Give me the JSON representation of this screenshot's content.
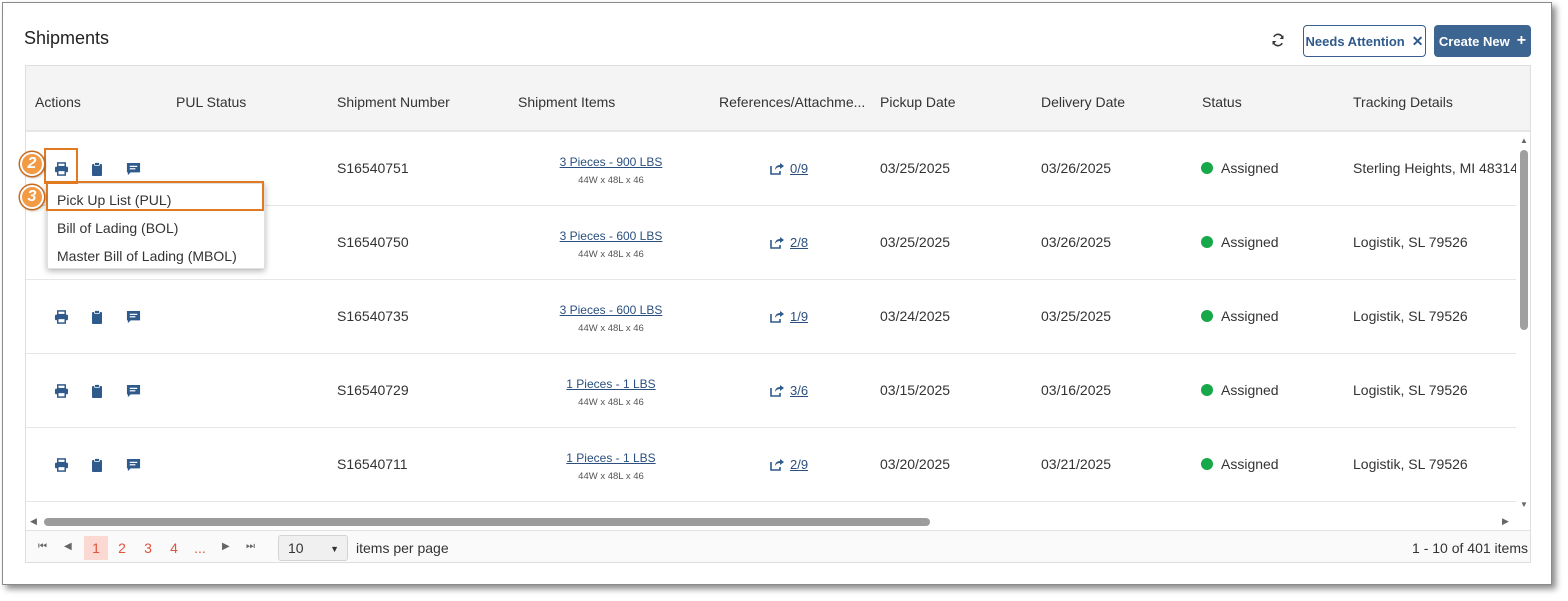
{
  "page": {
    "title": "Shipments"
  },
  "toolbar": {
    "needs_attention_label": "Needs Attention",
    "needs_attention_close": "✕",
    "create_new_label": "Create New",
    "create_new_icon": "+"
  },
  "columns": {
    "actions": "Actions",
    "pul_status": "PUL Status",
    "shipment_number": "Shipment Number",
    "shipment_items": "Shipment Items",
    "references": "References/Attachme...",
    "pickup_date": "Pickup Date",
    "delivery_date": "Delivery Date",
    "status": "Status",
    "tracking": "Tracking Details"
  },
  "rows": [
    {
      "number": "S16540751",
      "items": "3 Pieces - 900 LBS",
      "dims": "44W x 48L x 46",
      "refs": "0/9",
      "pickup": "03/25/2025",
      "delivery": "03/26/2025",
      "status": "Assigned",
      "tracking": "Sterling Heights, MI 48314"
    },
    {
      "number": "S16540750",
      "items": "3 Pieces - 600 LBS",
      "dims": "44W x 48L x 46",
      "refs": "2/8",
      "pickup": "03/25/2025",
      "delivery": "03/26/2025",
      "status": "Assigned",
      "tracking": "Logistik, SL 79526"
    },
    {
      "number": "S16540735",
      "items": "3 Pieces - 600 LBS",
      "dims": "44W x 48L x 46",
      "refs": "1/9",
      "pickup": "03/24/2025",
      "delivery": "03/25/2025",
      "status": "Assigned",
      "tracking": "Logistik, SL 79526"
    },
    {
      "number": "S16540729",
      "items": "1 Pieces - 1 LBS",
      "dims": "44W x 48L x 46",
      "refs": "3/6",
      "pickup": "03/15/2025",
      "delivery": "03/16/2025",
      "status": "Assigned",
      "tracking": "Logistik, SL 79526"
    },
    {
      "number": "S16540711",
      "items": "1 Pieces - 1 LBS",
      "dims": "44W x 48L x 46",
      "refs": "2/9",
      "pickup": "03/20/2025",
      "delivery": "03/21/2025",
      "status": "Assigned",
      "tracking": "Logistik, SL 79526"
    }
  ],
  "print_menu": {
    "items": [
      "Pick Up List (PUL)",
      "Bill of Lading (BOL)",
      "Master Bill of Lading (MBOL)"
    ]
  },
  "callouts": {
    "step_2": "2",
    "step_3": "3"
  },
  "pagination": {
    "pages": [
      "1",
      "2",
      "3",
      "4",
      "..."
    ],
    "current_page": "1",
    "page_size": "10",
    "items_per_page_label": "items per page",
    "range_label": "1 - 10 of 401 items"
  },
  "icons": {
    "refresh": "refresh-icon",
    "print": "printer-icon",
    "clipboard": "clipboard-icon",
    "comment": "comment-icon",
    "share": "share-icon"
  },
  "colors": {
    "primary": "#3c6591",
    "link": "#2b4f7e",
    "status_green": "#17a84a",
    "highlight": "#e07b22",
    "pager_accent": "#e0533c"
  }
}
